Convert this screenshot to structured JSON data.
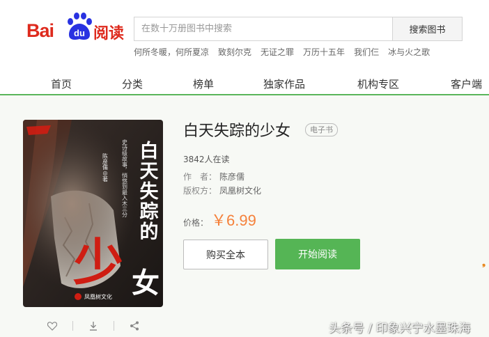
{
  "header": {
    "logo": {
      "text_en": "Bai",
      "paw_text": "du",
      "text_cn": "阅读"
    },
    "search": {
      "placeholder": "在数十万册图书中搜索",
      "value": "",
      "button_label": "搜索图书"
    },
    "hot_searches": [
      "何所冬暖，何所夏凉",
      "致刻尔克",
      "无证之罪",
      "万历十五年",
      "我们仨",
      "冰与火之歌"
    ]
  },
  "nav": {
    "items": [
      "首页",
      "分类",
      "榜单",
      "独家作品",
      "机构专区",
      "客户端"
    ]
  },
  "book": {
    "title": "白天失踪的少女",
    "badge": "电子书",
    "readers": "3842人在读",
    "author_label": "作　者：",
    "author": "陈彦儒",
    "rights_label": "版权方：",
    "rights_holder": "凤凰树文化",
    "price_label": "价格：",
    "price": "￥6.99",
    "buy_label": "购买全本",
    "read_label": "开始阅读",
    "cover": {
      "title_chars_top": "白天失踪的",
      "title_chars_big": "少",
      "title_chars_last": "女",
      "tagline_1": "史诗级故事，悄悠到最入木三分",
      "author_line": "陈彦儒◎著",
      "publisher": "凤凰树文化",
      "colors": {
        "red": "#cf1d12",
        "bg_dark": "#2b2421"
      }
    }
  },
  "actions": {
    "icons": [
      "heart-icon",
      "download-icon",
      "share-icon"
    ]
  },
  "watermark": "头条号 / 印象兴宁水墨珠海",
  "colors": {
    "accent_green": "#55b555",
    "nav_line": "#59b55a",
    "price_orange": "#f5813b",
    "logo_red": "#de2a1d",
    "logo_blue": "#2932e1"
  }
}
